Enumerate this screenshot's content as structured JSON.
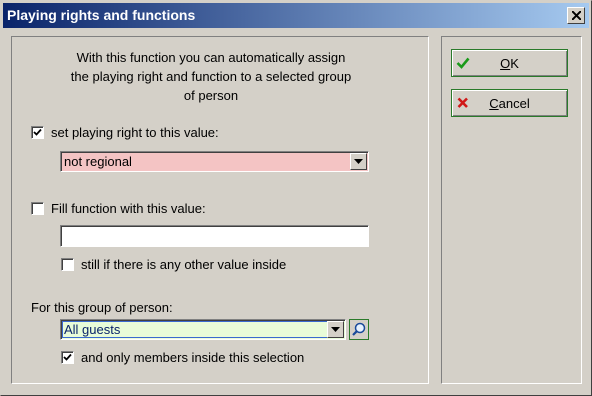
{
  "window": {
    "title": "Playing rights and functions"
  },
  "description": {
    "line1": "With this function you can automatically assign",
    "line2": "the playing right and function to a selected group",
    "line3": "of person"
  },
  "playing_right": {
    "checked": true,
    "label": "set playing right to this value:",
    "selected": "not regional",
    "bg_color": "#f4c4c4"
  },
  "function": {
    "checked": false,
    "label": "Fill function with this value:",
    "value": "",
    "still_checked": false,
    "still_label": "still if there is any other value inside"
  },
  "group": {
    "label": "For this group of person:",
    "selected": "All guests",
    "bg_color": "#e8fcd8",
    "only_members_checked": true,
    "only_members_label": "and only members inside this selection"
  },
  "buttons": {
    "ok_label_underlined": "O",
    "ok_label_rest": "K",
    "cancel_label_underlined": "C",
    "cancel_label_rest": "ancel"
  },
  "icons": {
    "close": "close-icon",
    "ok": "checkmark-icon",
    "cancel": "red-x-icon",
    "search": "magnifier-icon",
    "dropdown": "chevron-down-icon"
  },
  "colors": {
    "title_gradient_start": "#0a246a",
    "title_gradient_end": "#a6caf0",
    "ok_icon": "#1a9a1a",
    "cancel_icon": "#d01818",
    "button_border": "#2a7a2a"
  }
}
